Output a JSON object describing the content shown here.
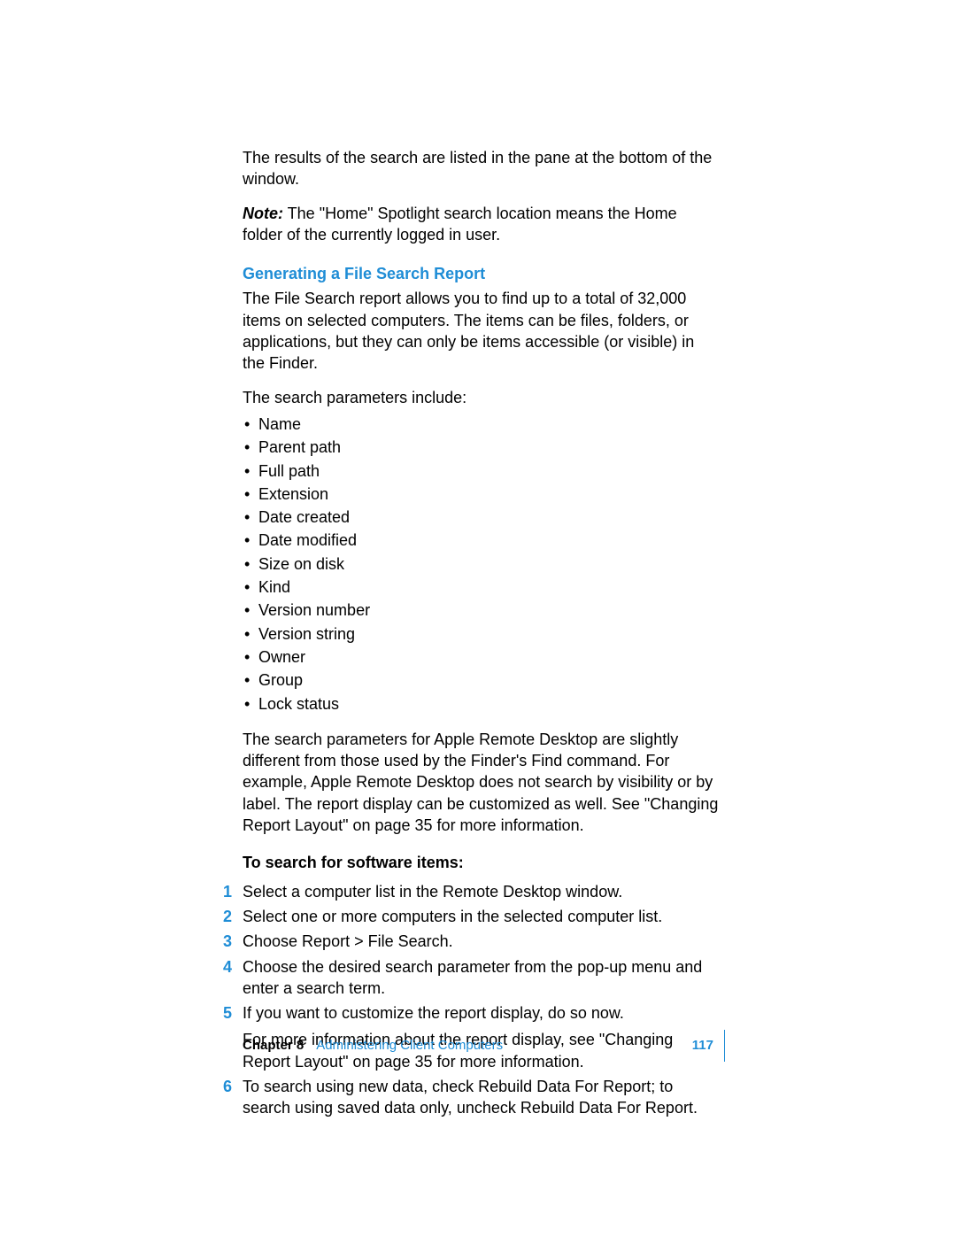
{
  "intro": {
    "results_line": "The results of the search are listed in the pane at the bottom of the window.",
    "note_label": "Note:",
    "note_text": " The \"Home\" Spotlight search location means the Home folder of the currently logged in user."
  },
  "section": {
    "heading": "Generating a File Search Report",
    "intro": "The File Search report allows you to find up to a total of 32,000 items on selected computers. The items can be files, folders, or applications, but they can only be items accessible (or visible) in the Finder.",
    "params_lead": "The search parameters include:",
    "params": [
      "Name",
      "Parent path",
      "Full path",
      "Extension",
      "Date created",
      "Date modified",
      "Size on disk",
      "Kind",
      "Version number",
      "Version string",
      "Owner",
      "Group",
      "Lock status"
    ],
    "diff_para": "The search parameters for Apple Remote Desktop are slightly different from those used by the Finder's Find command. For example, Apple Remote Desktop does not search by visibility or by label. The report display can be customized as well. See \"Changing Report Layout\" on page 35 for more information."
  },
  "steps": {
    "heading": "To search for software items:",
    "items": [
      {
        "text": "Select a computer list in the Remote Desktop window."
      },
      {
        "text": "Select one or more computers in the selected computer list."
      },
      {
        "text": "Choose Report > File Search."
      },
      {
        "text": "Choose the desired search parameter from the pop-up menu and enter a search term."
      },
      {
        "text": "If you want to customize the report display, do so now.",
        "sub": "For more information about the report display, see \"Changing Report Layout\" on page 35 for more information."
      },
      {
        "text": "To search using new data, check Rebuild Data For Report; to search using saved data only, uncheck Rebuild Data For Report."
      }
    ]
  },
  "footer": {
    "chapter_label": "Chapter 8",
    "chapter_title": "Administering Client Computers",
    "page_number": "117"
  }
}
